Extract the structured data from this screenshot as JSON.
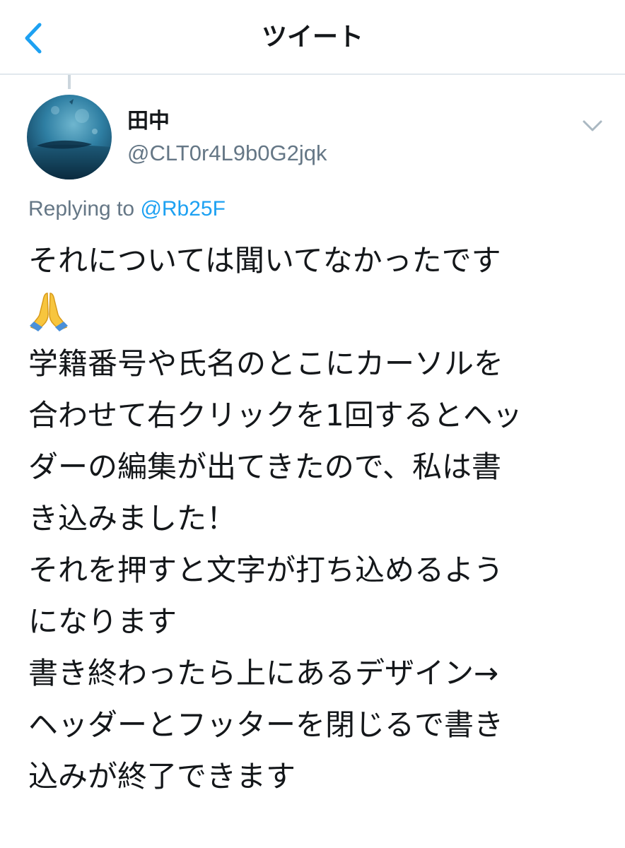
{
  "nav": {
    "back_icon": "chevron-left-icon",
    "title": "ツイート"
  },
  "tweet": {
    "author": {
      "name": "田中",
      "handle": "@CLT0r4L9b0G2jqk",
      "avatar_icon": "underwater-photo-avatar"
    },
    "menu_icon": "chevron-down-icon",
    "replying_prefix": "Replying to ",
    "replying_to": "@Rb25F",
    "emoji_icon": "folded-hands-emoji",
    "text_lines": [
      "それについては聞いてなかったです",
      "学籍番号や氏名のとこにカーソルを",
      "合わせて右クリックを1回するとヘッ",
      "ダーの編集が出てきたので、私は書",
      "き込みました！",
      "それを押すと文字が打ち込めるよう",
      "になります",
      "書き終わったら上にあるデザイン→",
      "ヘッダーとフッターを閉じるで書き",
      "込みが終了できます"
    ]
  },
  "colors": {
    "accent": "#1da1f2",
    "secondary_text": "#657786",
    "primary_text": "#14171a",
    "divider": "#e1e8ed"
  }
}
